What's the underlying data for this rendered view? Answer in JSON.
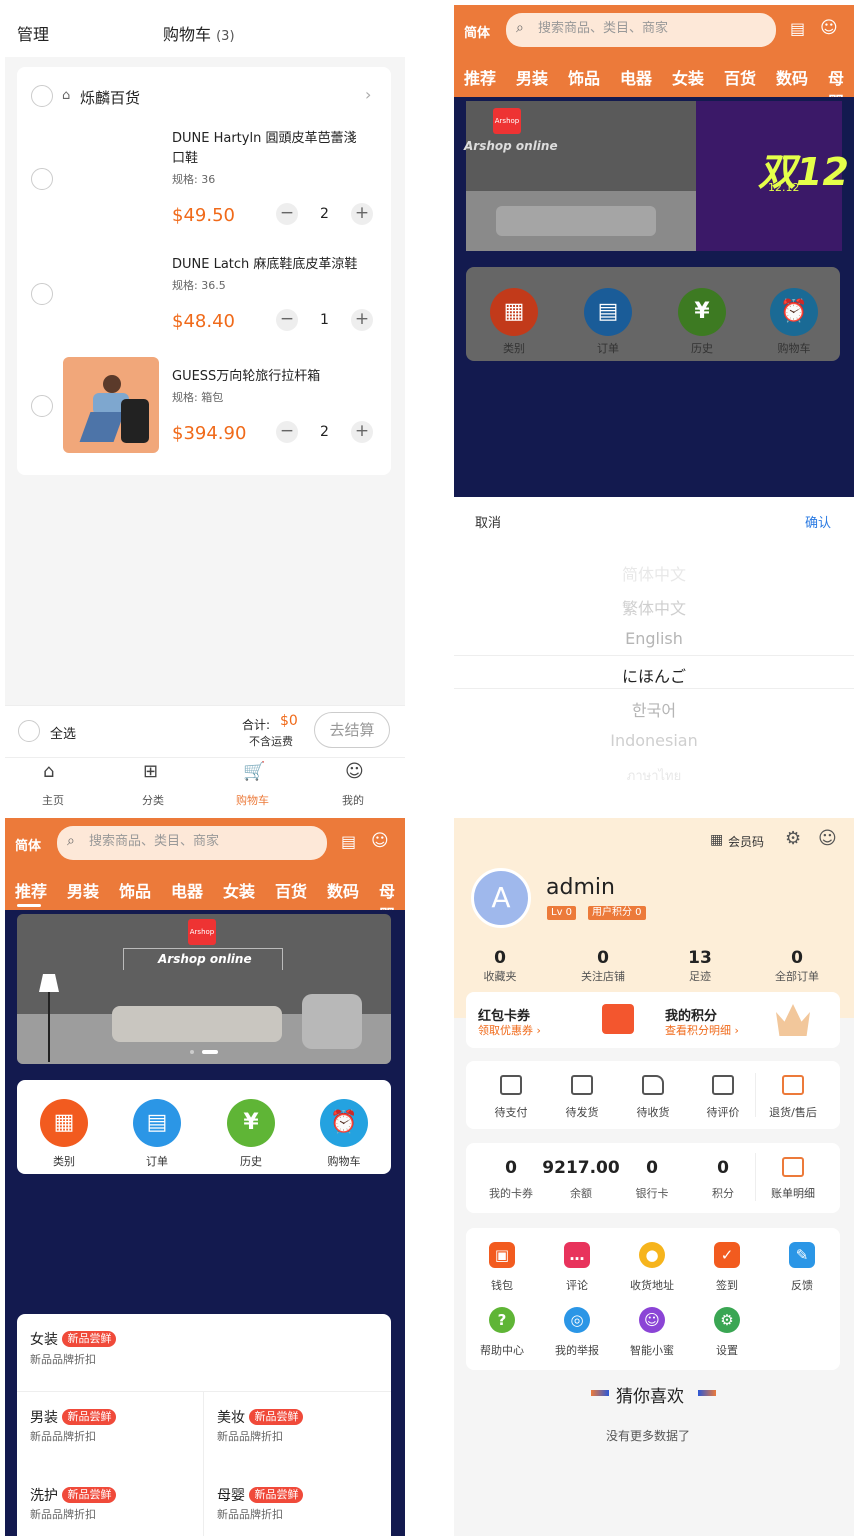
{
  "cart": {
    "manage": "管理",
    "title": "购物车",
    "count": "(3)",
    "store_name": "烁麟百货",
    "items": [
      {
        "name_line1": "DUNE Hartyln 圓頭皮革芭蕾淺",
        "name_line2": "口鞋",
        "spec_label": "规格:",
        "spec": "36",
        "price": "$49.50",
        "qty": "2"
      },
      {
        "name_line1": "DUNE Latch 麻底鞋底皮革涼鞋",
        "spec_label": "规格:",
        "spec": "36.5",
        "price": "$48.40",
        "qty": "1"
      },
      {
        "name_line1": "GUESS万向轮旅行拉杆箱",
        "spec_label": "规格:",
        "spec": "箱包",
        "price": "$394.90",
        "qty": "2"
      }
    ],
    "select_all": "全选",
    "total_label": "合计:",
    "total": "$0",
    "shipping_note": "不含运费",
    "checkout": "去结算",
    "tabs": [
      "主页",
      "分类",
      "购物车",
      "我的"
    ]
  },
  "home": {
    "lang_btn": "简体",
    "search_placeholder": "搜索商品、类目、商家",
    "categories": [
      "推荐",
      "男装",
      "饰品",
      "电器",
      "女装",
      "百货",
      "数码",
      "母婴"
    ],
    "banner_logo": "Arshop",
    "banner_text": "Arshop online",
    "promo_text": "双12",
    "promo_date": "12.12",
    "quick": [
      "类别",
      "订单",
      "历史",
      "购物车"
    ],
    "sections": [
      {
        "title": "女装",
        "badge": "新品尝鲜",
        "sub": "新品品牌折扣"
      },
      {
        "title": "男装",
        "badge": "新品尝鲜",
        "sub": "新品品牌折扣"
      },
      {
        "title": "美妆",
        "badge": "新品尝鲜",
        "sub": "新品品牌折扣"
      },
      {
        "title": "洗护",
        "badge": "新品尝鲜",
        "sub": "新品品牌折扣"
      },
      {
        "title": "母婴",
        "badge": "新品尝鲜",
        "sub": "新品品牌折扣"
      }
    ]
  },
  "picker": {
    "cancel": "取消",
    "confirm": "确认",
    "options": [
      "简体中文",
      "繁体中文",
      "English",
      "にほんご",
      "한국어",
      "Indonesian",
      "ภาษาไทย"
    ]
  },
  "profile": {
    "member_code": "会员码",
    "avatar_letter": "A",
    "username": "admin",
    "level": "Lv 0",
    "points_badge": "用户积分 0",
    "stats": [
      {
        "n": "0",
        "l": "收藏夹"
      },
      {
        "n": "0",
        "l": "关注店铺"
      },
      {
        "n": "13",
        "l": "足迹"
      },
      {
        "n": "0",
        "l": "全部订单"
      }
    ],
    "coupon_title": "红包卡券",
    "coupon_sub": "领取优惠券",
    "points_title": "我的积分",
    "points_sub": "查看积分明细",
    "orders": [
      "待支付",
      "待发货",
      "待收货",
      "待评价",
      "退货/售后"
    ],
    "wallet": [
      {
        "n": "0",
        "l": "我的卡券"
      },
      {
        "n": "9217.00",
        "l": "余额"
      },
      {
        "n": "0",
        "l": "银行卡"
      },
      {
        "n": "0",
        "l": "积分"
      }
    ],
    "bill": "账单明细",
    "services": [
      "钱包",
      "评论",
      "收货地址",
      "签到",
      "反馈",
      "帮助中心",
      "我的举报",
      "智能小蜜",
      "设置"
    ],
    "guess": "猜你喜欢",
    "no_more": "没有更多数据了"
  },
  "colors": {
    "accent": "#ec7a3a",
    "price": "#f06a1a",
    "navy": "#131a4f",
    "confirm": "#2a7ae2"
  }
}
